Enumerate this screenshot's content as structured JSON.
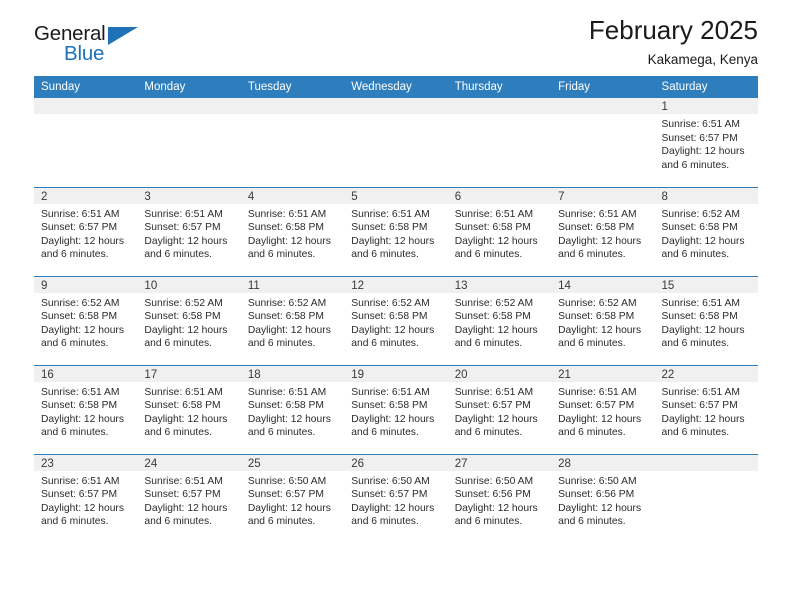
{
  "logo": {
    "text_top": "General",
    "text_bottom": "Blue",
    "accent_color": "#1f72b8"
  },
  "header": {
    "title": "February 2025",
    "subtitle": "Kakamega, Kenya"
  },
  "theme": {
    "header_blue": "#2e7ebd",
    "daynum_gray": "#f0f0f0"
  },
  "weekday_headers": [
    "Sunday",
    "Monday",
    "Tuesday",
    "Wednesday",
    "Thursday",
    "Friday",
    "Saturday"
  ],
  "weeks": [
    [
      {
        "day": "",
        "empty": true
      },
      {
        "day": "",
        "empty": true
      },
      {
        "day": "",
        "empty": true
      },
      {
        "day": "",
        "empty": true
      },
      {
        "day": "",
        "empty": true
      },
      {
        "day": "",
        "empty": true
      },
      {
        "day": "1",
        "sunrise": "Sunrise: 6:51 AM",
        "sunset": "Sunset: 6:57 PM",
        "daylight": "Daylight: 12 hours and 6 minutes."
      }
    ],
    [
      {
        "day": "2",
        "sunrise": "Sunrise: 6:51 AM",
        "sunset": "Sunset: 6:57 PM",
        "daylight": "Daylight: 12 hours and 6 minutes."
      },
      {
        "day": "3",
        "sunrise": "Sunrise: 6:51 AM",
        "sunset": "Sunset: 6:57 PM",
        "daylight": "Daylight: 12 hours and 6 minutes."
      },
      {
        "day": "4",
        "sunrise": "Sunrise: 6:51 AM",
        "sunset": "Sunset: 6:58 PM",
        "daylight": "Daylight: 12 hours and 6 minutes."
      },
      {
        "day": "5",
        "sunrise": "Sunrise: 6:51 AM",
        "sunset": "Sunset: 6:58 PM",
        "daylight": "Daylight: 12 hours and 6 minutes."
      },
      {
        "day": "6",
        "sunrise": "Sunrise: 6:51 AM",
        "sunset": "Sunset: 6:58 PM",
        "daylight": "Daylight: 12 hours and 6 minutes."
      },
      {
        "day": "7",
        "sunrise": "Sunrise: 6:51 AM",
        "sunset": "Sunset: 6:58 PM",
        "daylight": "Daylight: 12 hours and 6 minutes."
      },
      {
        "day": "8",
        "sunrise": "Sunrise: 6:52 AM",
        "sunset": "Sunset: 6:58 PM",
        "daylight": "Daylight: 12 hours and 6 minutes."
      }
    ],
    [
      {
        "day": "9",
        "sunrise": "Sunrise: 6:52 AM",
        "sunset": "Sunset: 6:58 PM",
        "daylight": "Daylight: 12 hours and 6 minutes."
      },
      {
        "day": "10",
        "sunrise": "Sunrise: 6:52 AM",
        "sunset": "Sunset: 6:58 PM",
        "daylight": "Daylight: 12 hours and 6 minutes."
      },
      {
        "day": "11",
        "sunrise": "Sunrise: 6:52 AM",
        "sunset": "Sunset: 6:58 PM",
        "daylight": "Daylight: 12 hours and 6 minutes."
      },
      {
        "day": "12",
        "sunrise": "Sunrise: 6:52 AM",
        "sunset": "Sunset: 6:58 PM",
        "daylight": "Daylight: 12 hours and 6 minutes."
      },
      {
        "day": "13",
        "sunrise": "Sunrise: 6:52 AM",
        "sunset": "Sunset: 6:58 PM",
        "daylight": "Daylight: 12 hours and 6 minutes."
      },
      {
        "day": "14",
        "sunrise": "Sunrise: 6:52 AM",
        "sunset": "Sunset: 6:58 PM",
        "daylight": "Daylight: 12 hours and 6 minutes."
      },
      {
        "day": "15",
        "sunrise": "Sunrise: 6:51 AM",
        "sunset": "Sunset: 6:58 PM",
        "daylight": "Daylight: 12 hours and 6 minutes."
      }
    ],
    [
      {
        "day": "16",
        "sunrise": "Sunrise: 6:51 AM",
        "sunset": "Sunset: 6:58 PM",
        "daylight": "Daylight: 12 hours and 6 minutes."
      },
      {
        "day": "17",
        "sunrise": "Sunrise: 6:51 AM",
        "sunset": "Sunset: 6:58 PM",
        "daylight": "Daylight: 12 hours and 6 minutes."
      },
      {
        "day": "18",
        "sunrise": "Sunrise: 6:51 AM",
        "sunset": "Sunset: 6:58 PM",
        "daylight": "Daylight: 12 hours and 6 minutes."
      },
      {
        "day": "19",
        "sunrise": "Sunrise: 6:51 AM",
        "sunset": "Sunset: 6:58 PM",
        "daylight": "Daylight: 12 hours and 6 minutes."
      },
      {
        "day": "20",
        "sunrise": "Sunrise: 6:51 AM",
        "sunset": "Sunset: 6:57 PM",
        "daylight": "Daylight: 12 hours and 6 minutes."
      },
      {
        "day": "21",
        "sunrise": "Sunrise: 6:51 AM",
        "sunset": "Sunset: 6:57 PM",
        "daylight": "Daylight: 12 hours and 6 minutes."
      },
      {
        "day": "22",
        "sunrise": "Sunrise: 6:51 AM",
        "sunset": "Sunset: 6:57 PM",
        "daylight": "Daylight: 12 hours and 6 minutes."
      }
    ],
    [
      {
        "day": "23",
        "sunrise": "Sunrise: 6:51 AM",
        "sunset": "Sunset: 6:57 PM",
        "daylight": "Daylight: 12 hours and 6 minutes."
      },
      {
        "day": "24",
        "sunrise": "Sunrise: 6:51 AM",
        "sunset": "Sunset: 6:57 PM",
        "daylight": "Daylight: 12 hours and 6 minutes."
      },
      {
        "day": "25",
        "sunrise": "Sunrise: 6:50 AM",
        "sunset": "Sunset: 6:57 PM",
        "daylight": "Daylight: 12 hours and 6 minutes."
      },
      {
        "day": "26",
        "sunrise": "Sunrise: 6:50 AM",
        "sunset": "Sunset: 6:57 PM",
        "daylight": "Daylight: 12 hours and 6 minutes."
      },
      {
        "day": "27",
        "sunrise": "Sunrise: 6:50 AM",
        "sunset": "Sunset: 6:56 PM",
        "daylight": "Daylight: 12 hours and 6 minutes."
      },
      {
        "day": "28",
        "sunrise": "Sunrise: 6:50 AM",
        "sunset": "Sunset: 6:56 PM",
        "daylight": "Daylight: 12 hours and 6 minutes."
      },
      {
        "day": "",
        "empty": true
      }
    ]
  ]
}
